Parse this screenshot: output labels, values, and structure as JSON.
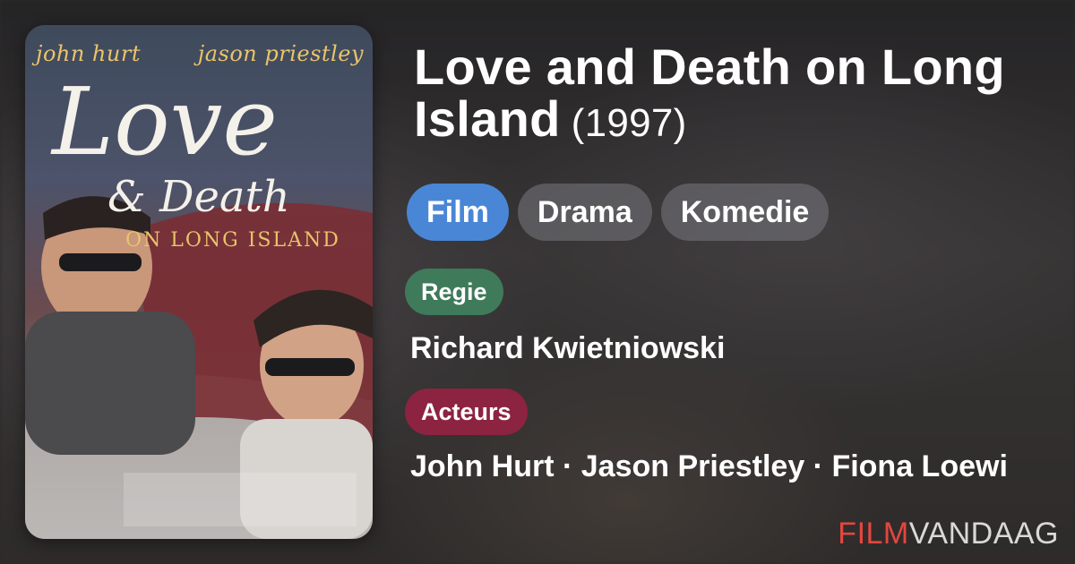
{
  "poster": {
    "actor_left": "john hurt",
    "actor_right": "jason priestley",
    "title_line1": "Love",
    "title_line2": "& Death",
    "title_line3": "ON LONG ISLAND"
  },
  "movie": {
    "title": "Love and Death on Long Island",
    "year": "(1997)"
  },
  "tags": [
    "Film",
    "Drama",
    "Komedie"
  ],
  "regie": {
    "label": "Regie",
    "value": "Richard Kwietniowski"
  },
  "acteurs": {
    "label": "Acteurs",
    "value": "John Hurt · Jason Priestley · Fiona Loewi"
  },
  "brand": {
    "part1": "FILM",
    "part2": "VANDAAG"
  },
  "colors": {
    "tag_accent": "#4a86d6",
    "regie_badge": "#3f7a5a",
    "acteurs_badge": "#8c2340",
    "brand_red": "#e3473f"
  }
}
